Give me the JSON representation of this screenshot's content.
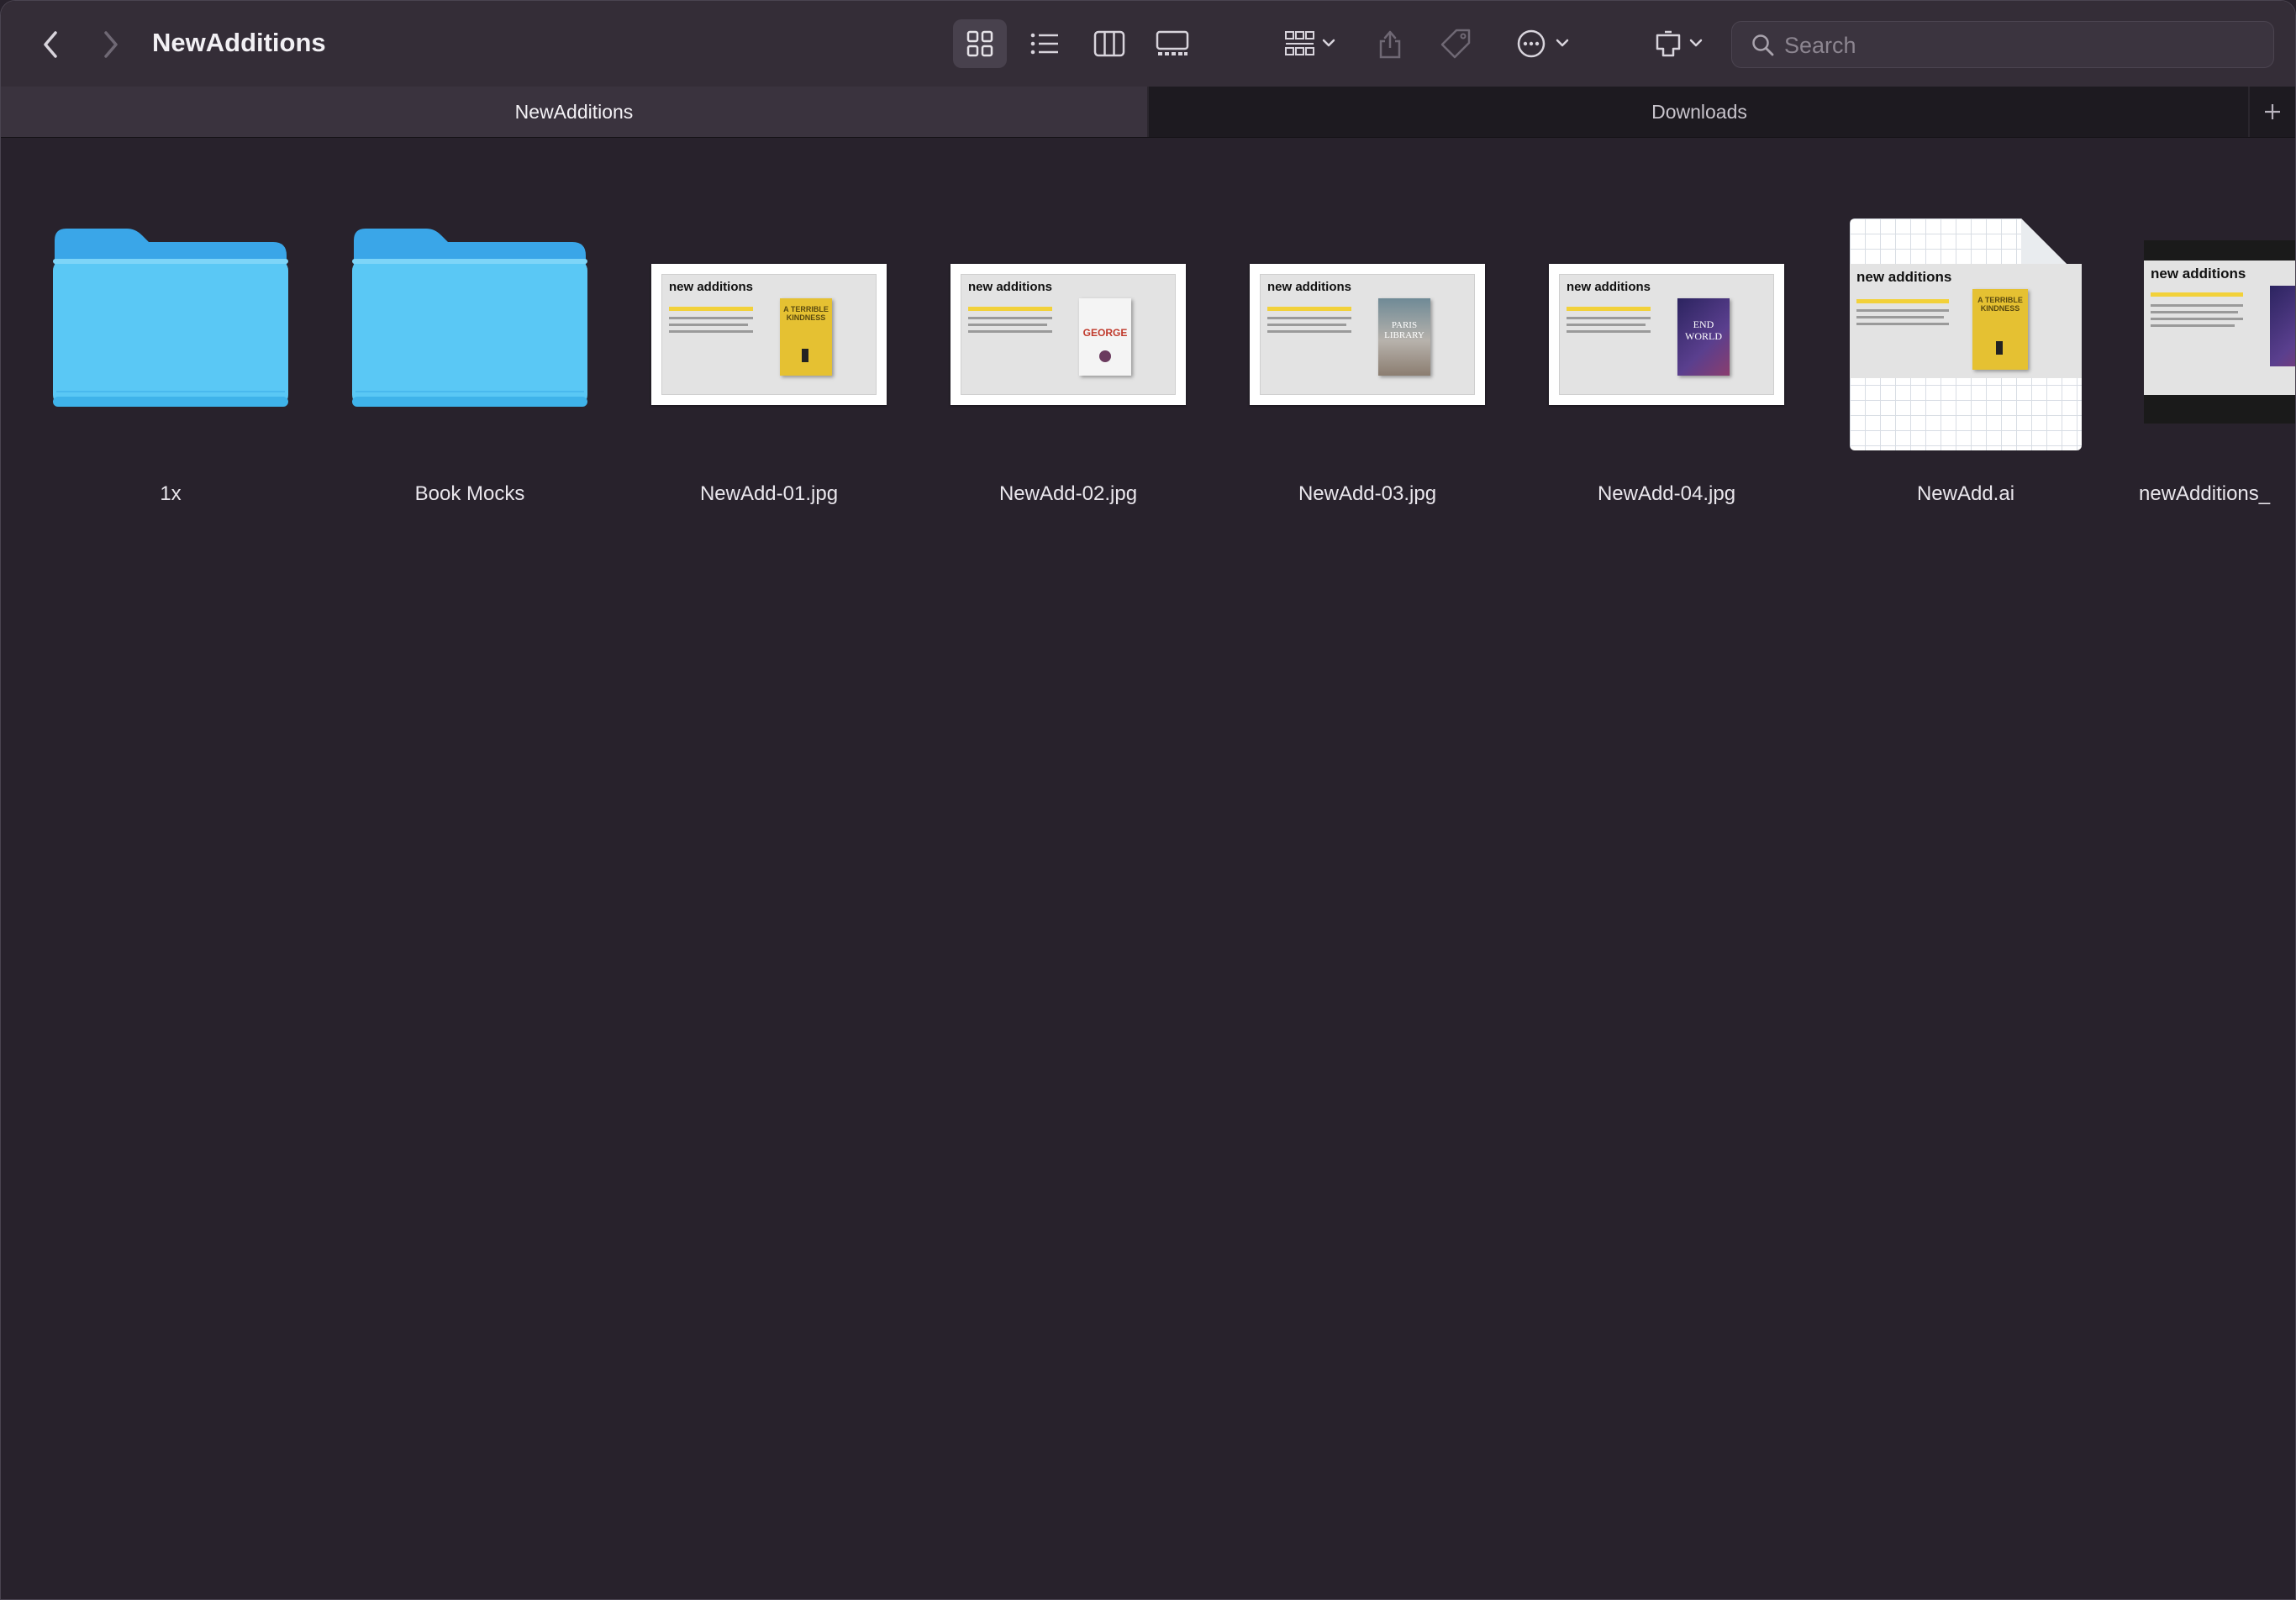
{
  "window": {
    "title": "NewAdditions"
  },
  "toolbar": {
    "back_icon": "chevron-left-icon",
    "forward_icon": "chevron-right-icon",
    "view_icons": [
      "icon-grid-view-icon",
      "list-view-icon",
      "column-view-icon",
      "gallery-view-icon"
    ],
    "selected_view": "icon-grid-view-icon",
    "group_icon": "group-by-icon",
    "share_icon": "share-icon",
    "tag_icon": "tag-icon",
    "more_icon": "ellipsis-icon",
    "device_icon": "device-icon"
  },
  "search": {
    "placeholder": "Search",
    "value": ""
  },
  "tabs": [
    {
      "label": "NewAdditions",
      "active": true
    },
    {
      "label": "Downloads",
      "active": false
    }
  ],
  "files": [
    {
      "name": "1x",
      "kind": "folder"
    },
    {
      "name": "Book Mocks",
      "kind": "folder"
    },
    {
      "name": "NewAdd-01.jpg",
      "kind": "image",
      "heading": "new additions",
      "cover_text": "A TERRIBLE KINDNESS",
      "cover_color": "#e5c132"
    },
    {
      "name": "NewAdd-02.jpg",
      "kind": "image",
      "heading": "new additions",
      "cover_text": "GEORGE",
      "cover_color": "#f4f4f4"
    },
    {
      "name": "NewAdd-03.jpg",
      "kind": "image",
      "heading": "new additions",
      "cover_text": "PARIS LIBRARY",
      "cover_color": "#b7b2ac"
    },
    {
      "name": "NewAdd-04.jpg",
      "kind": "image",
      "heading": "new additions",
      "cover_text": "END WORLD",
      "cover_color": "#3a2e6e"
    },
    {
      "name": "NewAdd.ai",
      "kind": "illustrator",
      "heading": "new additions",
      "cover_text": "A TERRIBLE KINDNESS",
      "cover_color": "#e5c132"
    },
    {
      "name": "newAdditions_",
      "kind": "image",
      "heading": "new additions",
      "cover_color": "#2f2a6a"
    }
  ],
  "colors": {
    "folder": "#5ac8f5",
    "background": "#28222c",
    "toolbar": "#342d37"
  }
}
